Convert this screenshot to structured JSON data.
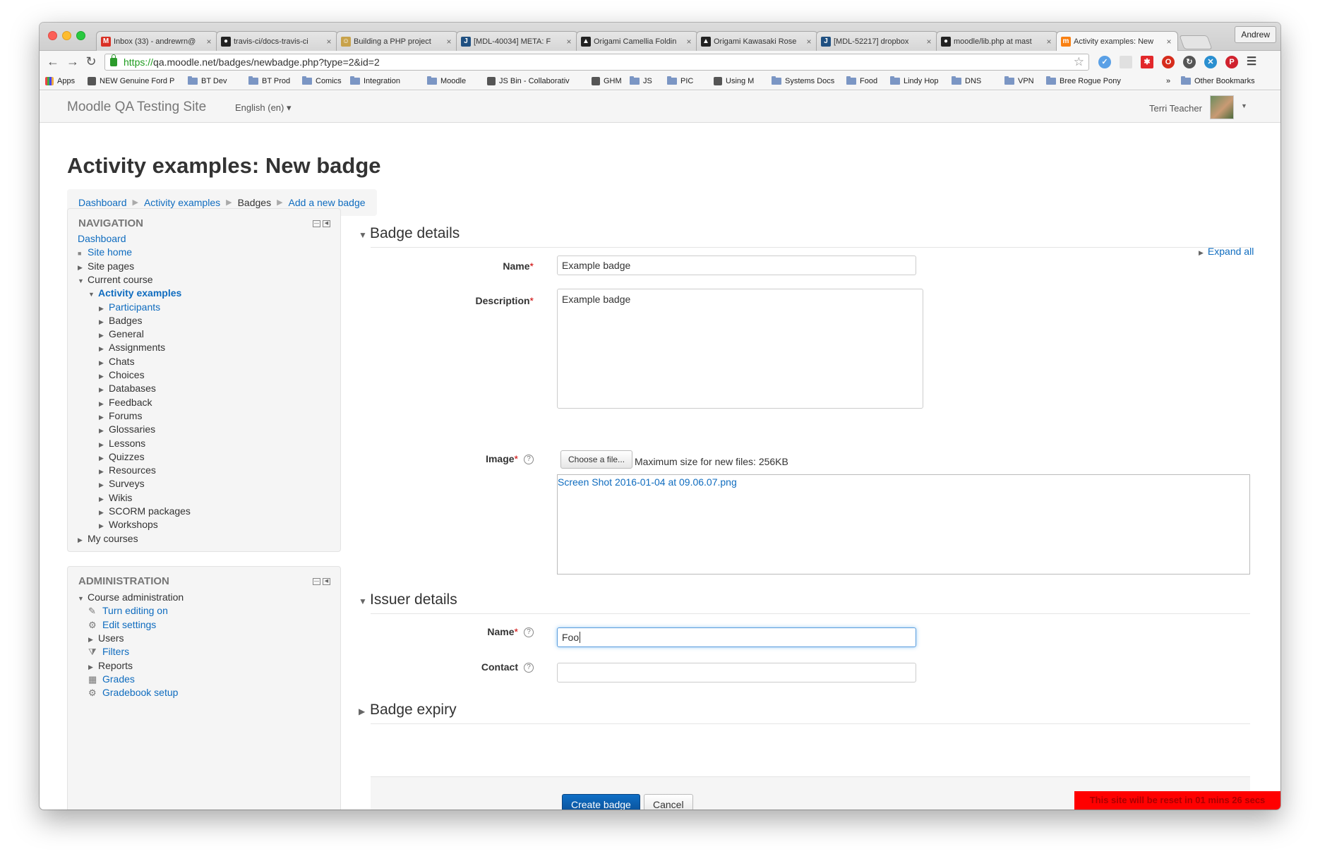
{
  "browser": {
    "tabs": [
      {
        "title": "Inbox (33) - andrewrn@",
        "favicon": "gmail-icon",
        "color": "#d93025"
      },
      {
        "title": "travis-ci/docs-travis-ci",
        "favicon": "github-icon",
        "color": "#222222"
      },
      {
        "title": "Building a PHP project",
        "favicon": "travis-icon",
        "color": "#c8a24a"
      },
      {
        "title": "[MDL-40034] META: F",
        "favicon": "jira-icon",
        "color": "#205081"
      },
      {
        "title": "Origami Camellia Foldin",
        "favicon": "origami-icon",
        "color": "#222222"
      },
      {
        "title": "Origami Kawasaki Rose",
        "favicon": "origami-icon",
        "color": "#222222"
      },
      {
        "title": "[MDL-52217] dropbox",
        "favicon": "jira-icon",
        "color": "#205081"
      },
      {
        "title": "moodle/lib.php at mast",
        "favicon": "github-icon",
        "color": "#222222"
      },
      {
        "title": "Activity examples: New",
        "favicon": "moodle-icon",
        "color": "#f98012"
      }
    ],
    "profile": "Andrew",
    "url_scheme": "https://",
    "url_rest": "qa.moodle.net/badges/newbadge.php?type=2&id=2",
    "bookmarks": [
      {
        "label": "Apps",
        "kind": "apps"
      },
      {
        "label": "NEW Genuine Ford P",
        "kind": "site"
      },
      {
        "label": "BT Dev",
        "kind": "folder"
      },
      {
        "label": "BT Prod",
        "kind": "folder"
      },
      {
        "label": "Comics",
        "kind": "folder"
      },
      {
        "label": "Integration",
        "kind": "folder"
      },
      {
        "label": "Moodle",
        "kind": "folder"
      },
      {
        "label": "JS Bin - Collaborativ",
        "kind": "site"
      },
      {
        "label": "GHM",
        "kind": "site"
      },
      {
        "label": "JS",
        "kind": "folder"
      },
      {
        "label": "PIC",
        "kind": "folder"
      },
      {
        "label": "Using M",
        "kind": "site"
      },
      {
        "label": "Systems Docs",
        "kind": "folder"
      },
      {
        "label": "Food",
        "kind": "folder"
      },
      {
        "label": "Lindy Hop",
        "kind": "folder"
      },
      {
        "label": "DNS",
        "kind": "folder"
      },
      {
        "label": "VPN",
        "kind": "folder"
      },
      {
        "label": "Bree Rogue Pony",
        "kind": "folder"
      },
      {
        "label": "»",
        "kind": "more"
      },
      {
        "label": "Other Bookmarks",
        "kind": "folder"
      }
    ]
  },
  "header": {
    "site_name": "Moodle QA Testing Site",
    "language": "English (en) ▾",
    "user_name": "Terri Teacher"
  },
  "page": {
    "title": "Activity examples: New badge",
    "breadcrumb": [
      "Dashboard",
      "Activity examples",
      "Badges",
      "Add a new badge"
    ]
  },
  "navigation": {
    "title": "NAVIGATION",
    "items": [
      {
        "label": "Dashboard",
        "level": 0,
        "marker": "none",
        "link": true
      },
      {
        "label": "Site home",
        "level": 0,
        "marker": "dot",
        "link": true
      },
      {
        "label": "Site pages",
        "level": 0,
        "marker": "closed",
        "link": false
      },
      {
        "label": "Current course",
        "level": 0,
        "marker": "open",
        "link": false
      },
      {
        "label": "Activity examples",
        "level": 1,
        "marker": "open",
        "link": true,
        "bold": true
      },
      {
        "label": "Participants",
        "level": 2,
        "marker": "closed",
        "link": true
      },
      {
        "label": "Badges",
        "level": 2,
        "marker": "closed",
        "link": false
      },
      {
        "label": "General",
        "level": 2,
        "marker": "closed",
        "link": false
      },
      {
        "label": "Assignments",
        "level": 2,
        "marker": "closed",
        "link": false
      },
      {
        "label": "Chats",
        "level": 2,
        "marker": "closed",
        "link": false
      },
      {
        "label": "Choices",
        "level": 2,
        "marker": "closed",
        "link": false
      },
      {
        "label": "Databases",
        "level": 2,
        "marker": "closed",
        "link": false
      },
      {
        "label": "Feedback",
        "level": 2,
        "marker": "closed",
        "link": false
      },
      {
        "label": "Forums",
        "level": 2,
        "marker": "closed",
        "link": false
      },
      {
        "label": "Glossaries",
        "level": 2,
        "marker": "closed",
        "link": false
      },
      {
        "label": "Lessons",
        "level": 2,
        "marker": "closed",
        "link": false
      },
      {
        "label": "Quizzes",
        "level": 2,
        "marker": "closed",
        "link": false
      },
      {
        "label": "Resources",
        "level": 2,
        "marker": "closed",
        "link": false
      },
      {
        "label": "Surveys",
        "level": 2,
        "marker": "closed",
        "link": false
      },
      {
        "label": "Wikis",
        "level": 2,
        "marker": "closed",
        "link": false
      },
      {
        "label": "SCORM packages",
        "level": 2,
        "marker": "closed",
        "link": false
      },
      {
        "label": "Workshops",
        "level": 2,
        "marker": "closed",
        "link": false
      },
      {
        "label": "My courses",
        "level": 0,
        "marker": "closed",
        "link": false
      }
    ]
  },
  "administration": {
    "title": "ADMINISTRATION",
    "items": [
      {
        "label": "Course administration",
        "level": 0,
        "marker": "open",
        "link": false
      },
      {
        "label": "Turn editing on",
        "level": 1,
        "marker": "pencil-icon",
        "link": true
      },
      {
        "label": "Edit settings",
        "level": 1,
        "marker": "gear-icon",
        "link": true
      },
      {
        "label": "Users",
        "level": 1,
        "marker": "closed",
        "link": false
      },
      {
        "label": "Filters",
        "level": 1,
        "marker": "filter-icon",
        "link": true
      },
      {
        "label": "Reports",
        "level": 1,
        "marker": "closed",
        "link": false
      },
      {
        "label": "Grades",
        "level": 1,
        "marker": "table-icon",
        "link": true
      },
      {
        "label": "Gradebook setup",
        "level": 1,
        "marker": "gear-icon",
        "link": true
      }
    ]
  },
  "form": {
    "expand_all": "Expand all",
    "badge_details": "Badge details",
    "name_label": "Name",
    "name_value": "Example badge",
    "description_label": "Description",
    "description_value": "Example badge",
    "image_label": "Image",
    "choose_file": "Choose a file...",
    "max_size": "Maximum size for new files: 256KB",
    "file_name": "Screen Shot 2016-01-04 at 09.06.07.png",
    "issuer_details": "Issuer details",
    "issuer_name_label": "Name",
    "issuer_name_value": "Foo",
    "contact_label": "Contact",
    "contact_value": "",
    "badge_expiry": "Badge expiry",
    "required_mark": "*",
    "submit": "Create badge",
    "cancel": "Cancel"
  },
  "reset_notice": "This site will be reset in 01 mins 26 secs"
}
